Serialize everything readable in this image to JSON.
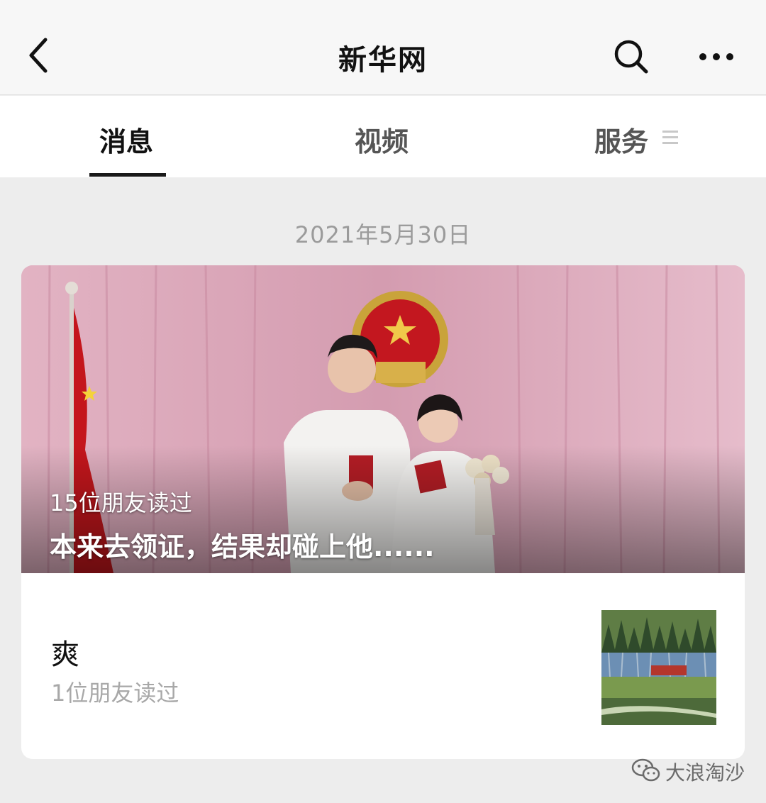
{
  "header": {
    "title": "新华网",
    "back_icon": "chevron-left-icon",
    "search_icon": "search-icon",
    "more_icon": "more-dots-icon"
  },
  "tabs": [
    {
      "label": "消息",
      "active": true
    },
    {
      "label": "视频",
      "active": false
    },
    {
      "label": "服务",
      "active": false,
      "icon": "menu-icon"
    }
  ],
  "feed": {
    "date": "2021年5月30日",
    "main_article": {
      "readers": "15位朋友读过",
      "title": "本来去领证，结果却碰上他......"
    },
    "sub_article": {
      "title": "爽",
      "readers": "1位朋友读过"
    }
  },
  "watermark": {
    "icon": "wechat-icon",
    "text": "大浪淘沙"
  },
  "colors": {
    "nav_bg": "#f7f7f7",
    "page_bg": "#ededed",
    "muted_text": "#9b9b9b",
    "curtain_pink": "#d8a4b6"
  }
}
